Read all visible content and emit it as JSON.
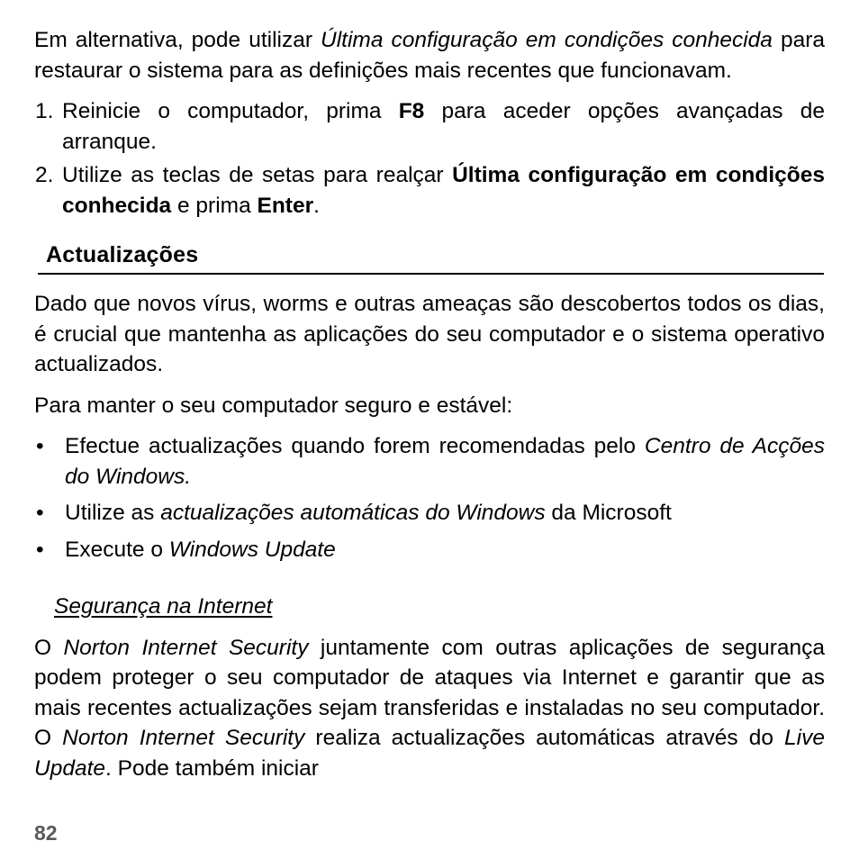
{
  "document": {
    "language": "pt-PT",
    "page_number": "82",
    "intro_paragraph": {
      "part1": "Em alternativa, pode utilizar ",
      "italic1": "Última configuração em condições conhecida",
      "part2": " para restaurar o sistema para as definições mais recentes que funcionavam."
    },
    "numbered_list": [
      {
        "marker": "1.",
        "part1": "Reinicie o computador, prima ",
        "bold1": "F8",
        "part2": " para aceder opções avançadas de arranque."
      },
      {
        "marker": "2.",
        "part1": "Utilize as teclas de setas para realçar ",
        "bold1": "Última configuração em condições conhecida",
        "part2": " e prima ",
        "bold2": "Enter",
        "part3": "."
      }
    ],
    "section": {
      "heading": "Actualizações",
      "paragraph1": "Dado que novos vírus, worms e outras ameaças são descobertos todos os dias, é crucial que mantenha as aplicações do seu computador e o sistema operativo actualizados.",
      "paragraph2": "Para manter o seu computador seguro e estável:",
      "bullets": [
        {
          "bullet": "•",
          "part1": "Efectue actualizações quando forem recomendadas pelo ",
          "italic1": "Centro de Acções do Windows."
        },
        {
          "bullet": "•",
          "part1": "Utilize as ",
          "italic1": "actualizações automáticas do Windows",
          "part2": " da Microsoft"
        },
        {
          "bullet": "•",
          "part1": "Execute o ",
          "italic1": "Windows Update"
        }
      ]
    },
    "subsection": {
      "heading": "Segurança na Internet",
      "paragraph": {
        "part1": "O ",
        "italic1": "Norton Internet Security",
        "part2": " juntamente com outras aplicações de segurança podem proteger o seu computador de ataques via Internet e garantir que as mais recentes actualizações sejam transferidas e instaladas no seu computador. O ",
        "italic2": "Norton Internet Security",
        "part3": " realiza actualizações automáticas através do ",
        "italic3": "Live Update",
        "part4": ". Pode também iniciar"
      }
    }
  }
}
